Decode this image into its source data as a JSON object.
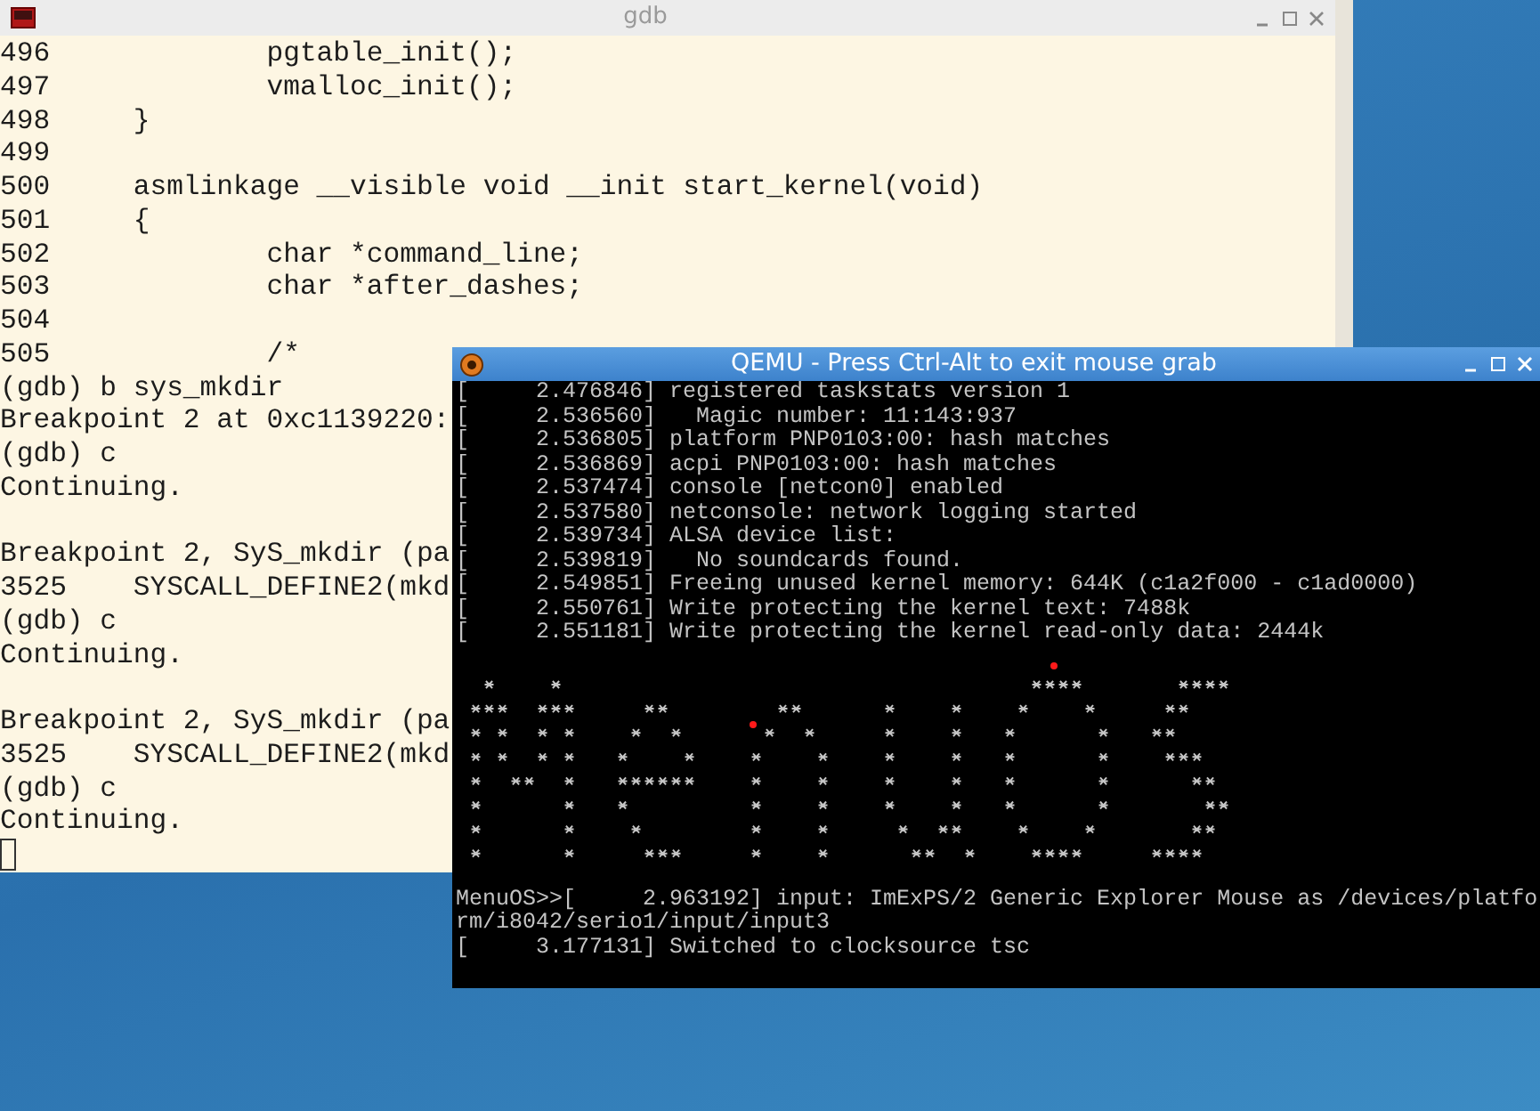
{
  "gdb_window": {
    "title": "gdb",
    "blocks": [
      [
        "496             pgtable_init();",
        "497             vmalloc_init();",
        "498     }",
        "499",
        "500     asmlinkage __visible void __init start_kernel(void)",
        "501     {",
        "502             char *command_line;",
        "503             char *after_dashes;",
        "504",
        "505             /*",
        "(gdb) b sys_mkdir",
        "Breakpoint 2 at 0xc1139220:",
        "(gdb) c",
        "Continuing."
      ],
      [
        "Breakpoint 2, SyS_mkdir (pa",
        "3525    SYSCALL_DEFINE2(mkd",
        "(gdb) c",
        "Continuing."
      ],
      [
        "Breakpoint 2, SyS_mkdir (pa",
        "3525    SYSCALL_DEFINE2(mkd",
        "(gdb) c",
        "Continuing."
      ]
    ]
  },
  "qemu_window": {
    "title": "QEMU - Press Ctrl-Alt to exit mouse grab",
    "boot_log": [
      "[     2.476846] registered taskstats version 1",
      "[     2.536560]   Magic number: 11:143:937",
      "[     2.536805] platform PNP0103:00: hash matches",
      "[     2.536869] acpi PNP0103:00: hash matches",
      "[     2.537474] console [netcon0] enabled",
      "[     2.537580] netconsole: network logging started",
      "[     2.539734] ALSA device list:",
      "[     2.539819]   No soundcards found.",
      "[     2.549851] Freeing unused kernel memory: 644K (c1a2f000 - c1ad0000)",
      "[     2.550761] Write protecting the kernel text: 7488k",
      "[     2.551181] Write protecting the kernel read-only data: 2444k"
    ],
    "console": [
      "MenuOS>>[     2.963192] input: ImExPS/2 Generic Explorer Mouse as /devices/platfo",
      "rm/i8042/serio1/input/input3",
      "[     3.177131] Switched to clocksource tsc"
    ]
  }
}
